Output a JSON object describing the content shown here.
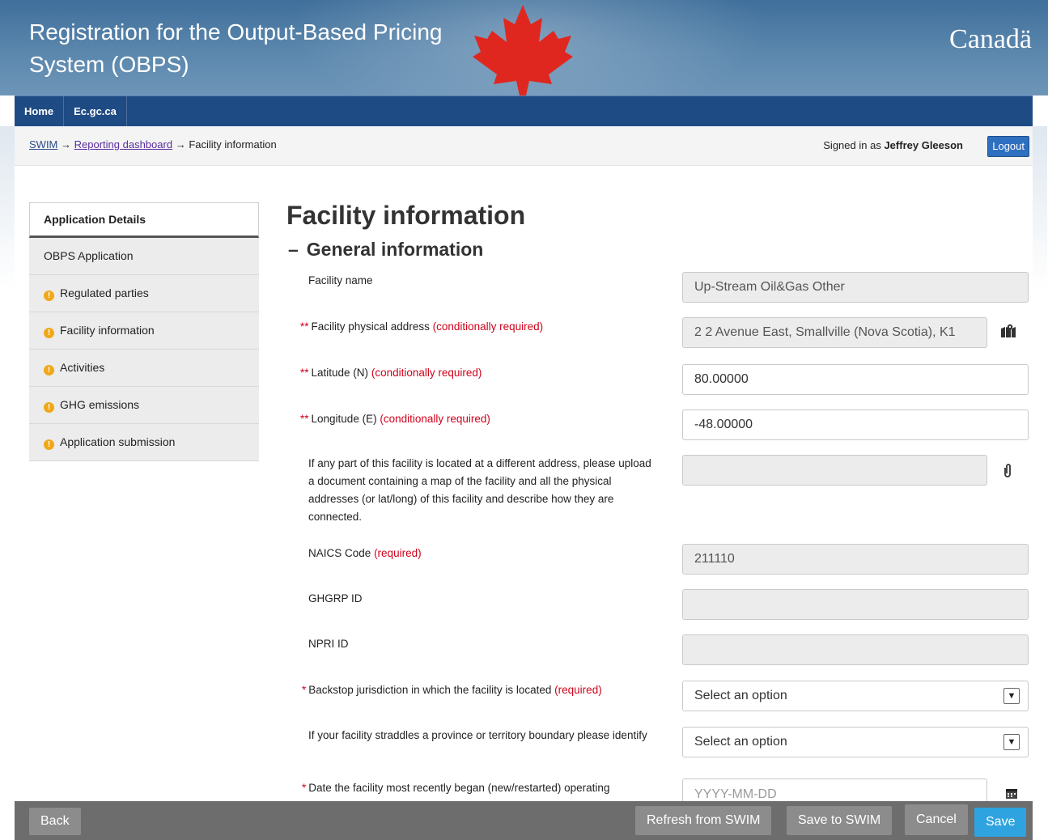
{
  "header": {
    "app_title": "Registration for the Output-Based Pricing System (OBPS)",
    "wordmark": "Canadä"
  },
  "nav": [
    {
      "label": "Home"
    },
    {
      "label": "Ec.gc.ca"
    }
  ],
  "breadcrumb": {
    "items": [
      "SWIM",
      "Reporting dashboard"
    ],
    "current": "Facility information",
    "separator": "→"
  },
  "user": {
    "signed_in_prefix": "Signed in as",
    "name": "Jeffrey Gleeson",
    "logout_label": "Logout"
  },
  "sidebar": {
    "items": [
      {
        "label": "Application Details",
        "warning": false,
        "active": true
      },
      {
        "label": "OBPS Application",
        "warning": false
      },
      {
        "label": "Regulated parties",
        "warning": true
      },
      {
        "label": "Facility information",
        "warning": true
      },
      {
        "label": "Activities",
        "warning": true
      },
      {
        "label": "GHG emissions",
        "warning": true
      },
      {
        "label": "Application submission",
        "warning": true
      }
    ],
    "warning_glyph": "!"
  },
  "page": {
    "title": "Facility information",
    "section_title": "General information",
    "collapse_glyph": "–"
  },
  "form": {
    "facility_name": {
      "label": "Facility name",
      "value": "Up-Stream Oil&Gas Other"
    },
    "address": {
      "marker": "**",
      "label": "Facility physical address",
      "note": "(conditionally required)",
      "value": "2 2 Avenue East, Smallville (Nova Scotia), K1"
    },
    "latitude": {
      "marker": "**",
      "label": "Latitude (N)",
      "note": "(conditionally required)",
      "value": "80.00000"
    },
    "longitude": {
      "marker": "**",
      "label": "Longitude (E)",
      "note": "(conditionally required)",
      "value": "-48.00000"
    },
    "upload": {
      "label": "If any part of this facility is located at a different address, please upload a document containing a map of the facility and all the physical addresses (or lat/long) of this facility and describe how they are connected.",
      "value": ""
    },
    "naics": {
      "label": "NAICS Code",
      "note": "(required)",
      "value": "211110"
    },
    "ghgrp": {
      "label": "GHGRP ID",
      "value": ""
    },
    "npri": {
      "label": "NPRI ID",
      "value": ""
    },
    "backstop": {
      "marker": "*",
      "label": "Backstop jurisdiction in which the facility is located",
      "note": "(required)",
      "value": "Select an option"
    },
    "straddle": {
      "label": "If your facility straddles a province or territory boundary please identify",
      "value": "Select an option"
    },
    "date": {
      "marker": "*",
      "label": "Date the facility most recently began (new/restarted) operating",
      "placeholder": "YYYY-MM-DD"
    }
  },
  "icons": {
    "map": "map-icon",
    "paperclip": "paperclip-icon",
    "calendar": "calendar-icon",
    "dropdown": "chevron-down-icon"
  },
  "footer": {
    "back": "Back",
    "refresh": "Refresh from SWIM",
    "save_swim": "Save to SWIM",
    "cancel": "Cancel",
    "save": "Save"
  },
  "colors": {
    "banner": "#4a79a3",
    "nav": "#1f4b84",
    "required": "#d0021b",
    "save": "#2ea3e0",
    "footer": "#6d6d6d"
  }
}
